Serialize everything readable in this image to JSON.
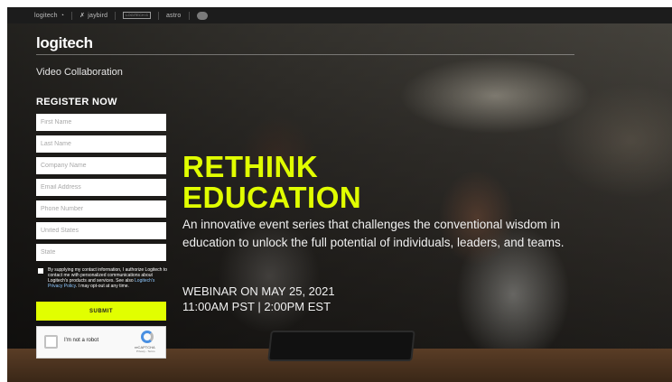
{
  "topbar": {
    "brands": [
      "logitech",
      "jaybird",
      "LOGITECH G",
      "astro",
      "ultimate ears"
    ]
  },
  "header": {
    "logo": "logitech",
    "subtitle": "Video Collaboration"
  },
  "form": {
    "title": "REGISTER NOW",
    "fields": {
      "first_name": "First Name",
      "last_name": "Last Name",
      "company_name": "Company Name",
      "email": "Email Address",
      "phone": "Phone Number",
      "country": "United States",
      "state": "State"
    },
    "consent_text_1": "By supplying my contact information, I authorize Logitech to contact me with personalized communications about Logitech's products and services. See also ",
    "consent_link": "Logitech's Privacy Policy",
    "consent_text_2": ". I may opt-out at any time.",
    "submit_label": "SUBMIT",
    "captcha": {
      "label": "I'm not a robot",
      "brand": "reCAPTCHA",
      "links": "Privacy - Terms"
    }
  },
  "hero": {
    "headline_line1": "RETHINK",
    "headline_line2": "EDUCATION",
    "description": "An innovative event series that challenges the conventional wisdom in education to unlock the full potential of individuals, leaders, and teams.",
    "event_date": "WEBINAR ON MAY 25, 2021",
    "event_time": "11:00AM PST | 2:00PM EST"
  },
  "colors": {
    "accent": "#e1ff00",
    "topbar": "#1c1c1c"
  }
}
